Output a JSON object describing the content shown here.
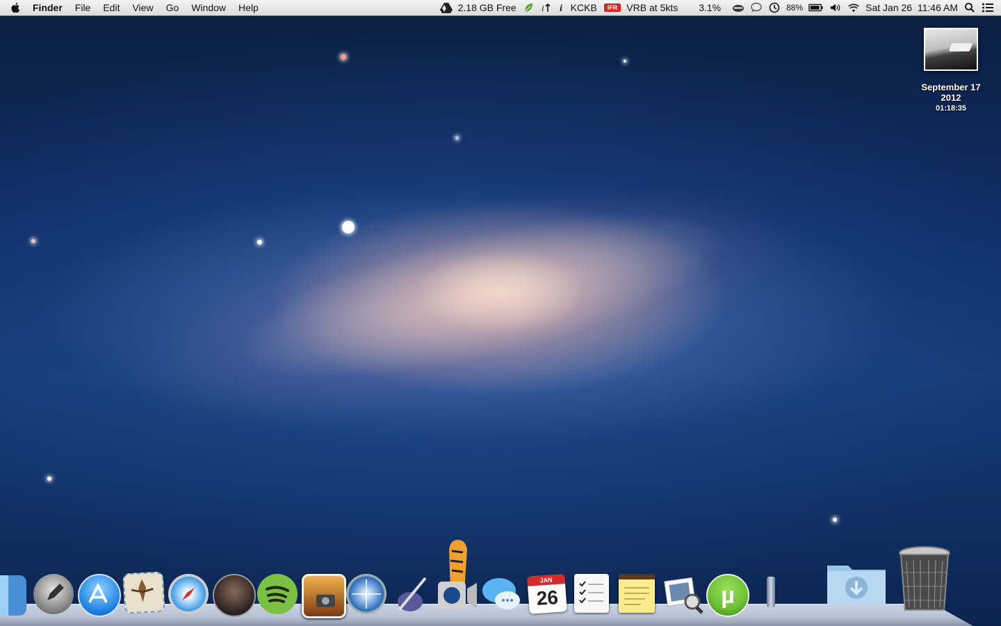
{
  "menubar": {
    "app_name": "Finder",
    "menus": [
      "File",
      "Edit",
      "View",
      "Go",
      "Window",
      "Help"
    ],
    "status": {
      "disk_free": "2.18 GB Free",
      "airport": "KCKB",
      "flight_rules": "IFR",
      "wind": "VRB at 5kts",
      "cpu": "3.1%",
      "battery": "88%",
      "datetime": "Sat Jan 26  11:46 AM"
    }
  },
  "desktop": {
    "file": {
      "name_line1": "September 17",
      "name_line2": "2012",
      "subtitle": "01:18:35"
    }
  },
  "dock": {
    "calendar": {
      "month": "JAN",
      "day": "26"
    },
    "apps": [
      "finder-icon",
      "launchpad-icon",
      "app-store-icon",
      "mail-icon",
      "safari-icon",
      "album-art-app-icon",
      "spotify-icon",
      "iphoto-icon",
      "network-utility-icon",
      "script-editor-icon",
      "facetime-icon",
      "messages-icon",
      "calendar-icon",
      "reminders-icon",
      "notes-icon",
      "preview-icon",
      "utorrent-icon"
    ],
    "stacks": [
      "downloads-folder-icon",
      "trash-icon"
    ]
  },
  "colors": {
    "menubar_bg": "#e6e6e6",
    "ifr_badge": "#d8231e",
    "spotify": "#7ac043",
    "utorrent": "#6bbf32",
    "safari_blue": "#1a7fe0"
  }
}
